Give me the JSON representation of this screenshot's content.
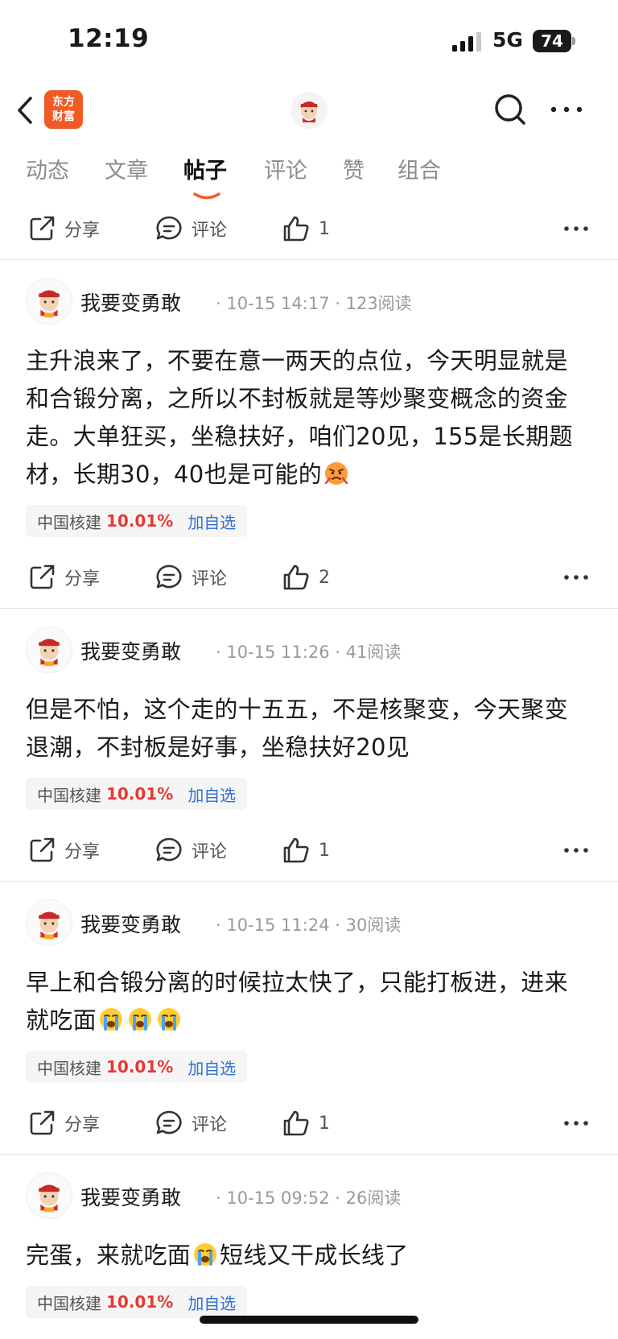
{
  "status_bar": {
    "time": "12:19",
    "network": "5G",
    "battery": "74"
  },
  "nav": {
    "logo_line1": "东方",
    "logo_line2": "财富",
    "brand_color": "#f15a24"
  },
  "tabs": [
    {
      "label": "动态"
    },
    {
      "label": "文章"
    },
    {
      "label": "帖子",
      "active": true
    },
    {
      "label": "评论"
    },
    {
      "label": "赞"
    },
    {
      "label": "组合"
    }
  ],
  "top_actions": {
    "share": "分享",
    "comment": "评论",
    "like_count": "1"
  },
  "posts": [
    {
      "author": "我要变勇敢",
      "meta": "· 10-15 14:17 · 123阅读",
      "body": "主升浪来了，不要在意一两天的点位，今天明显就是和合锻分离，之所以不封板就是等炒聚变概念的资金走。大单狂买，坐稳扶好，咱们20见，155是长期题材，长期30，40也是可能的",
      "emoji": "angry-face",
      "stock": {
        "name": "中国核建",
        "change": "10.01%",
        "add": "加自选"
      },
      "share": "分享",
      "comment": "评论",
      "likes": "2"
    },
    {
      "author": "我要变勇敢",
      "meta": "· 10-15 11:26 · 41阅读",
      "body": "但是不怕，这个走的十五五，不是核聚变，今天聚变退潮，不封板是好事，坐稳扶好20见",
      "stock": {
        "name": "中国核建",
        "change": "10.01%",
        "add": "加自选"
      },
      "share": "分享",
      "comment": "评论",
      "likes": "1"
    },
    {
      "author": "我要变勇敢",
      "meta": "· 10-15 11:24 · 30阅读",
      "body": "早上和合锻分离的时候拉太快了，只能打板进，进来就吃面",
      "emoji": "crying-face x3",
      "stock": {
        "name": "中国核建",
        "change": "10.01%",
        "add": "加自选"
      },
      "share": "分享",
      "comment": "评论",
      "likes": "1"
    },
    {
      "author": "我要变勇敢",
      "meta": "· 10-15 09:52 · 26阅读",
      "body_before": "完蛋，来就吃面",
      "body_after": "短线又干成长线了",
      "emoji": "crying-face",
      "stock": {
        "name": "中国核建",
        "change": "10.01%",
        "add": "加自选"
      }
    }
  ],
  "colors": {
    "up_red": "#e53935",
    "link_blue": "#2f6fd6",
    "tab_accent": "#f15a24"
  }
}
